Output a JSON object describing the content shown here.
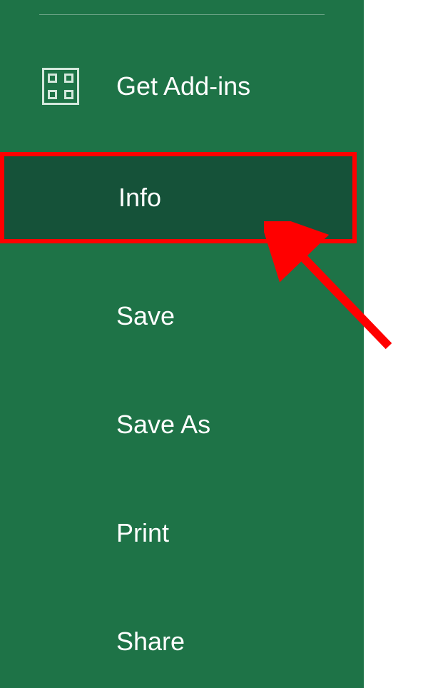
{
  "sidebar": {
    "items": [
      {
        "label": "Get Add-ins"
      },
      {
        "label": "Info"
      },
      {
        "label": "Save"
      },
      {
        "label": "Save As"
      },
      {
        "label": "Print"
      },
      {
        "label": "Share"
      }
    ]
  },
  "annotation": {
    "highlight_color": "#ff0000",
    "arrow_color": "#ff0000"
  }
}
